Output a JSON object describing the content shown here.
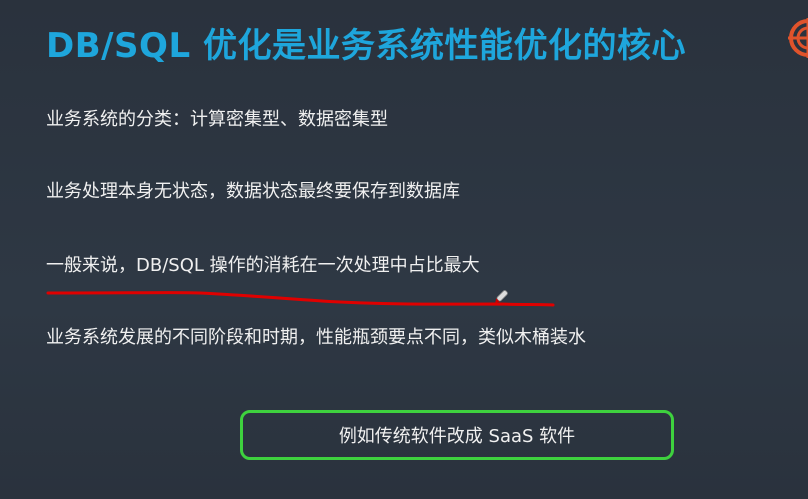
{
  "slide": {
    "title": "DB/SQL 优化是业务系统性能优化的核心",
    "bullets": [
      "业务系统的分类：计算密集型、数据密集型",
      "业务处理本身无状态，数据状态最终要保存到数据库",
      "一般来说，DB/SQL 操作的消耗在一次处理中占比最大",
      "业务系统发展的不同阶段和时期，性能瓶颈要点不同，类似木桶装水"
    ],
    "callout": "例如传统软件改成 SaaS 软件"
  },
  "colors": {
    "title": "#1ea6dc",
    "annotation": "#e00000",
    "callout_border": "#3ed13e",
    "logo": "#e0532b"
  }
}
